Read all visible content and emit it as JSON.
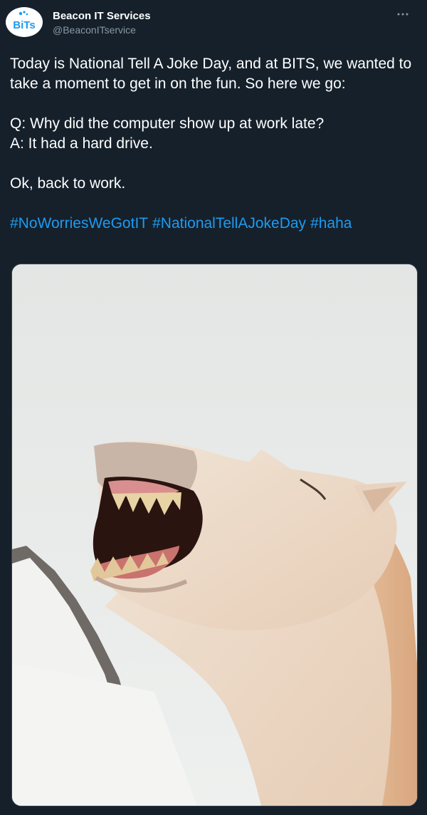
{
  "author": {
    "display_name": "Beacon IT Services",
    "handle": "@BeaconITservice",
    "avatar_text": "BiTs"
  },
  "tweet": {
    "lines": [
      "Today is National Tell A Joke Day, and at BITS, we wanted to take a moment to get in on the fun. So here we go:",
      "Q: Why did the computer show up at work late?",
      "A: It had a hard drive.",
      "Ok, back to work."
    ],
    "hashtags": [
      "#NoWorriesWeGotIT",
      "#NationalTellAJokeDay",
      "#haha"
    ]
  },
  "media": {
    "icon": "laughing-horse-photo"
  },
  "colors": {
    "background": "#15202b",
    "text": "#ffffff",
    "secondary": "#8899a6",
    "link": "#1d9bf0"
  },
  "icons": {
    "more": "more-horizontal-icon"
  }
}
